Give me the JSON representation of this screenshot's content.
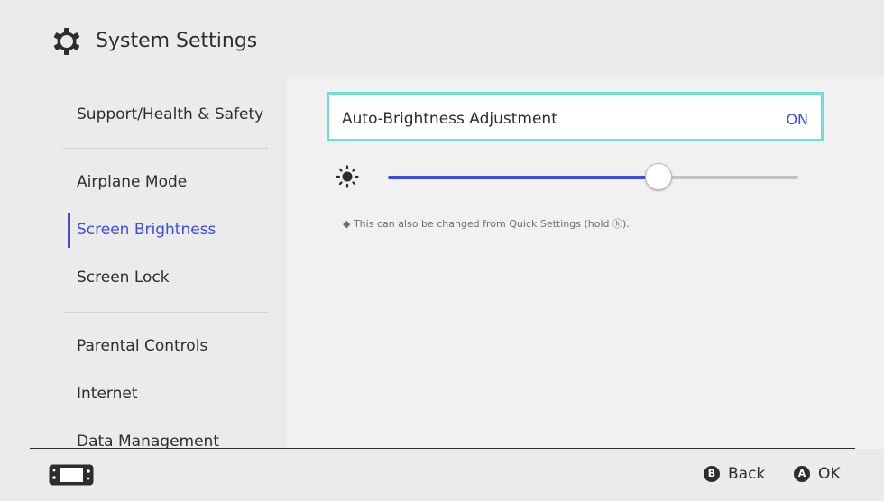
{
  "header": {
    "title": "System Settings",
    "icon": "gear-icon"
  },
  "sidebar": {
    "items": [
      {
        "label": "Support/Health & Safety"
      },
      {
        "label": "Airplane Mode"
      },
      {
        "label": "Screen Brightness",
        "active": true
      },
      {
        "label": "Screen Lock"
      },
      {
        "label": "Parental Controls"
      },
      {
        "label": "Internet"
      },
      {
        "label": "Data Management"
      }
    ]
  },
  "main": {
    "auto_brightness": {
      "label": "Auto-Brightness Adjustment",
      "value": "ON"
    },
    "brightness": {
      "icon": "sun-icon",
      "level": 0.66
    },
    "note": "◆ This can also be changed from Quick Settings (hold ⓗ)."
  },
  "footer": {
    "console_icon": "console-icon",
    "back": {
      "button": "B",
      "label": "Back"
    },
    "ok": {
      "button": "A",
      "label": "OK"
    }
  },
  "colors": {
    "accent": "#3c4ee0",
    "selection_border": "#6be0d3",
    "background": "#ebebeb",
    "text": "#2d2d2d"
  }
}
